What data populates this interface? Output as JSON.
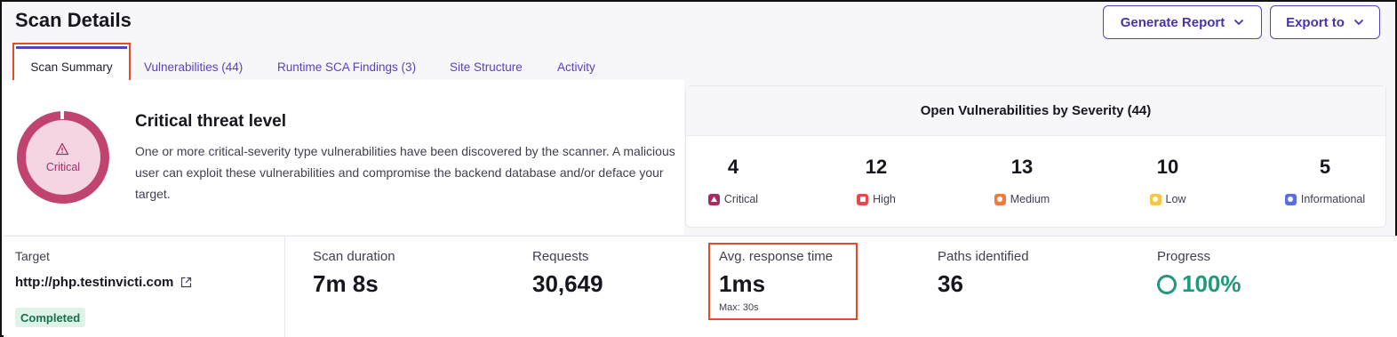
{
  "header": {
    "title": "Scan Details",
    "generate_report_label": "Generate Report",
    "export_label": "Export to"
  },
  "tabs": [
    {
      "label": "Scan Summary",
      "active": true
    },
    {
      "label": "Vulnerabilities (44)",
      "active": false
    },
    {
      "label": "Runtime SCA Findings (3)",
      "active": false
    },
    {
      "label": "Site Structure",
      "active": false
    },
    {
      "label": "Activity",
      "active": false
    }
  ],
  "threat": {
    "level_label": "Critical",
    "title": "Critical threat level",
    "description": "One or more critical-severity type vulnerabilities have been discovered by the scanner. A malicious user can exploit these vulnerabilities and compromise the backend database and/or deface your target.",
    "icon": "warning-triangle-icon",
    "color": "#c1436f"
  },
  "severity": {
    "title": "Open Vulnerabilities by Severity (44)",
    "items": [
      {
        "count": "4",
        "label": "Critical",
        "color": "#a72c63",
        "icon": "triangle-icon"
      },
      {
        "count": "12",
        "label": "High",
        "color": "#e5484d",
        "icon": "square-icon"
      },
      {
        "count": "13",
        "label": "Medium",
        "color": "#f07c3c",
        "icon": "circle-icon"
      },
      {
        "count": "10",
        "label": "Low",
        "color": "#f5c742",
        "icon": "circle-icon"
      },
      {
        "count": "5",
        "label": "Informational",
        "color": "#5b6ee1",
        "icon": "circle-icon"
      }
    ]
  },
  "stats": {
    "target_label": "Target",
    "target_url": "http://php.testinvicti.com",
    "status": "Completed",
    "scan_duration_label": "Scan duration",
    "scan_duration": "7m 8s",
    "requests_label": "Requests",
    "requests": "30,649",
    "avg_response_label": "Avg. response time",
    "avg_response": "1ms",
    "avg_response_max": "Max: 30s",
    "paths_label": "Paths identified",
    "paths": "36",
    "progress_label": "Progress",
    "progress": "100%",
    "progress_fraction": 1.0
  },
  "colors": {
    "accent": "#5b3fbf",
    "highlight": "#e44b2a",
    "success": "#1f9a7a"
  }
}
